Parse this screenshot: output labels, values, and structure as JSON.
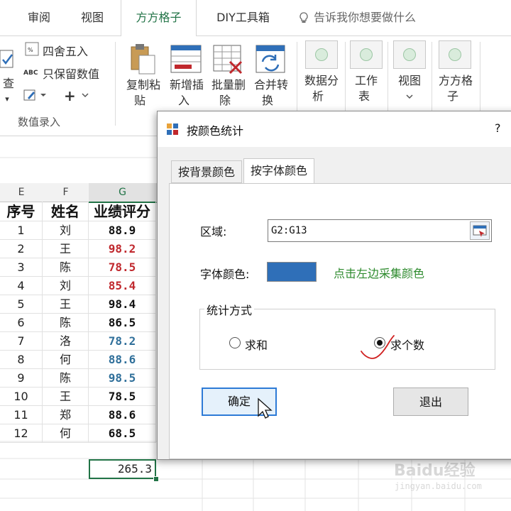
{
  "tabs": {
    "review": "审阅",
    "view": "视图",
    "fangfang": "方方格子",
    "diy": "DIY工具箱",
    "tellme": "告诉我你想要做什么"
  },
  "ribbon": {
    "partial_left1": "查",
    "partial_left2": "▾",
    "round_label": "四舍五入",
    "keep_values_label": "只保留数值",
    "plus_label": "+",
    "group_caption": "数值录入",
    "copy_paste_line1": "复制粘",
    "copy_paste_line2": "贴",
    "add_insert_line1": "新增插",
    "add_insert_line2": "入",
    "batch_delete_line1": "批量删",
    "batch_delete_line2": "除",
    "merge_convert_line1": "合并转",
    "merge_convert_line2": "换",
    "data_analysis_line1": "数据分",
    "data_analysis_line2": "析",
    "worksheet_line1": "工作",
    "worksheet_line2": "表",
    "view_line1": "视图",
    "fangfang_line1": "方方格",
    "fangfang_line2": "子"
  },
  "sheet": {
    "columns": [
      "E",
      "F",
      "G"
    ],
    "headers": [
      "序号",
      "姓名",
      "业绩评分"
    ],
    "rows": [
      {
        "no": "1",
        "name": "刘",
        "score": "88.9"
      },
      {
        "no": "2",
        "name": "王",
        "score": "98.2"
      },
      {
        "no": "3",
        "name": "陈",
        "score": "78.5"
      },
      {
        "no": "4",
        "name": "刘",
        "score": "85.4"
      },
      {
        "no": "5",
        "name": "王",
        "score": "98.4"
      },
      {
        "no": "6",
        "name": "陈",
        "score": "86.5"
      },
      {
        "no": "7",
        "name": "洛",
        "score": "78.2"
      },
      {
        "no": "8",
        "name": "何",
        "score": "88.6"
      },
      {
        "no": "9",
        "name": "陈",
        "score": "98.5"
      },
      {
        "no": "10",
        "name": "王",
        "score": "78.5"
      },
      {
        "no": "11",
        "name": "郑",
        "score": "88.6"
      },
      {
        "no": "12",
        "name": "何",
        "score": "68.5"
      }
    ],
    "score_colors": [
      "#111111",
      "#c0282d",
      "#c0282d",
      "#c0282d",
      "#111111",
      "#111111",
      "#2f6f9a",
      "#2f6f9a",
      "#2f6f9a",
      "#111111",
      "#111111",
      "#111111"
    ],
    "sum_value": "265.3"
  },
  "dialog": {
    "title": "按颜色统计",
    "help": "?",
    "tab_background": "按背景颜色",
    "tab_font": "按字体颜色",
    "range_label": "区域:",
    "range_value": "G2:G13",
    "font_color_label": "字体颜色:",
    "font_color_value": "#2f6fb8",
    "hint": "点击左边采集颜色",
    "method_legend": "统计方式",
    "option_sum": "求和",
    "option_count": "求个数",
    "selected_option": "count",
    "ok": "确定",
    "exit": "退出"
  },
  "watermark": {
    "text": "Baidu经验",
    "sub": "jingyan.baidu.com"
  }
}
